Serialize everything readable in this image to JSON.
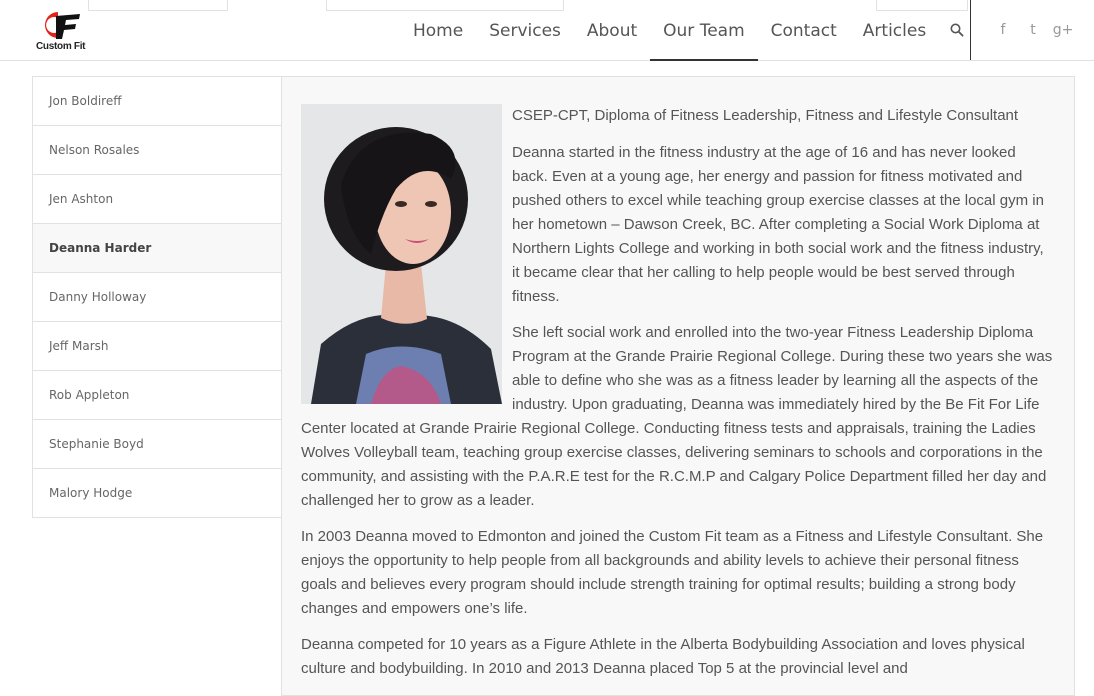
{
  "header": {
    "logo_text": "Custom Fit",
    "nav": [
      {
        "label": "Home"
      },
      {
        "label": "Services"
      },
      {
        "label": "About"
      },
      {
        "label": "Our Team",
        "active": true
      },
      {
        "label": "Contact"
      },
      {
        "label": "Articles"
      }
    ],
    "social": [
      {
        "icon": "facebook-icon",
        "glyph": "f"
      },
      {
        "icon": "twitter-icon",
        "glyph": "t"
      },
      {
        "icon": "google-plus-icon",
        "glyph": "g+"
      }
    ]
  },
  "sidebar": {
    "items": [
      {
        "label": "Jon Boldireff"
      },
      {
        "label": "Nelson Rosales"
      },
      {
        "label": "Jen Ashton"
      },
      {
        "label": "Deanna Harder",
        "active": true
      },
      {
        "label": "Danny Holloway"
      },
      {
        "label": "Jeff Marsh"
      },
      {
        "label": "Rob Appleton"
      },
      {
        "label": "Stephanie Boyd"
      },
      {
        "label": "Malory Hodge"
      }
    ]
  },
  "main": {
    "credentials": "CSEP-CPT, Diploma of Fitness Leadership, Fitness and Lifestyle Consultant",
    "paragraphs": [
      "Deanna started in the fitness industry at the age of 16 and has never looked back. Even at a young age, her energy and passion for fitness motivated and pushed others to excel while teaching group exercise classes at the local gym in her hometown – Dawson Creek, BC. After completing a Social Work Diploma at Northern Lights College and working in both social work and the fitness industry, it became clear that her calling to help people would be best served through fitness.",
      "She left social work and enrolled into the two-year Fitness Leadership Diploma Program at the Grande Prairie Regional College. During these two years she was able to define who she was as a fitness leader by learning all the aspects of the industry. Upon graduating, Deanna was immediately hired by the Be Fit For Life Center located at Grande Prairie Regional College. Conducting fitness tests and appraisals, training the Ladies Wolves Volleyball team, teaching group exercise classes, delivering seminars to schools and corporations in the community, and assisting with the P.A.R.E test for the R.C.M.P and Calgary Police Department filled her day and challenged her to grow as a leader.",
      "In 2003 Deanna moved to Edmonton and joined the Custom Fit team as a Fitness and Lifestyle Consultant. She enjoys the opportunity to help people from all backgrounds and ability levels to achieve their personal fitness goals and believes every program should include strength training for optimal results; building a strong body changes and empowers one’s life.",
      "Deanna competed for 10 years as a Figure Athlete in the Alberta Bodybuilding Association and loves physical culture and bodybuilding. In 2010 and 2013 Deanna placed Top 5 at the provincial level and"
    ]
  },
  "colors": {
    "logo_red": "#e2231a",
    "nav_text": "#555555",
    "border": "#e1e1e1",
    "content_bg": "#f8f8f8"
  }
}
